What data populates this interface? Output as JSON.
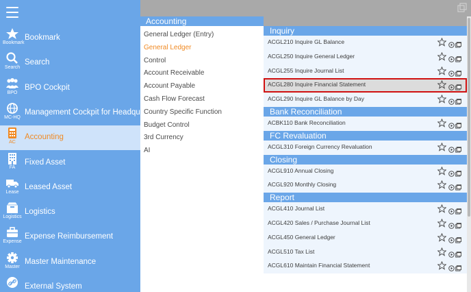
{
  "sidebar": {
    "items": [
      {
        "label": "Bookmark",
        "sub": "Bookmark",
        "icon": "star-icon"
      },
      {
        "label": "Search",
        "sub": "Search",
        "icon": "search-icon"
      },
      {
        "label": "BPO Cockpit",
        "sub": "BPO",
        "icon": "people-icon"
      },
      {
        "label": "Management Cockpit for Headquarters",
        "sub": "MC-HQ",
        "icon": "globe-icon"
      },
      {
        "label": "Accounting",
        "sub": "AC",
        "icon": "calculator-icon"
      },
      {
        "label": "Fixed Asset",
        "sub": "FA",
        "icon": "building-icon"
      },
      {
        "label": "Leased Asset",
        "sub": "Lease",
        "icon": "truck-icon"
      },
      {
        "label": "Logistics",
        "sub": "Logistics",
        "icon": "box-icon"
      },
      {
        "label": "Expense Reimbursement",
        "sub": "Expense",
        "icon": "briefcase-icon"
      },
      {
        "label": "Master Maintenance",
        "sub": "Master",
        "icon": "gear-icon"
      },
      {
        "label": "External System",
        "sub": "",
        "icon": "link-icon"
      }
    ],
    "active_index": 4
  },
  "menu": {
    "title": "Accounting",
    "items": [
      "General Ledger (Entry)",
      "General Ledger",
      "Control",
      "Account Receivable",
      "Account Payable",
      "Cash Flow Forecast",
      "Country Specific Function",
      "Budget Control",
      "3rd Currency",
      "AI"
    ],
    "active_index": 1
  },
  "sections": [
    {
      "title": "Inquiry",
      "rows": [
        "ACGL210 Inquire GL Balance",
        "ACGL250 Inquire General Ledger",
        "ACGL255 Inquire Journal List",
        "ACGL280 Inquire Financial Statement",
        "ACGL290 Inquire GL Balance by Day"
      ]
    },
    {
      "title": "Bank Reconciliation",
      "rows": [
        "ACBK110 Bank Reconciliation"
      ]
    },
    {
      "title": "FC Revaluation",
      "rows": [
        "ACGL310 Foreign Currency Revaluation"
      ]
    },
    {
      "title": "Closing",
      "rows": [
        "ACGL910 Annual Closing",
        "ACGL920 Monthly Closing"
      ]
    },
    {
      "title": "Report",
      "rows": [
        "ACGL410 Journal List",
        "ACGL420 Sales / Purchase Journal List",
        "ACGL450 General Ledger",
        "ACGL510 Tax List",
        "ACGL610 Maintain Financial Statement"
      ]
    }
  ],
  "selected_row": "ACGL280 Inquire Financial Statement",
  "colors": {
    "sidebar_bg": "#6aa6e8",
    "active_text": "#f08a24",
    "row_bg": "#eef5fd",
    "selection_outline": "#d01010"
  }
}
